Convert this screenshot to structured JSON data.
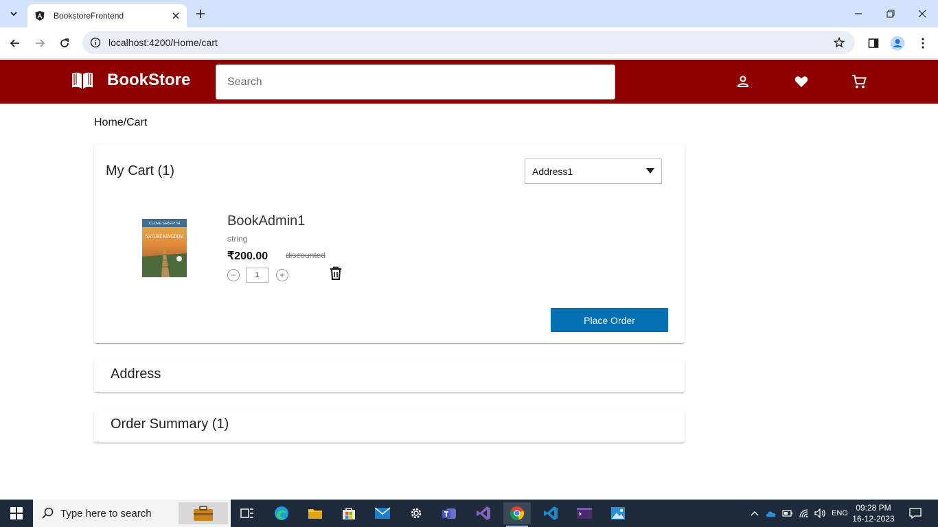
{
  "browser": {
    "tab_title": "BookstoreFrontend",
    "url": "localhost:4200/Home/cart"
  },
  "header": {
    "brand": "BookStore",
    "search_placeholder": "Search",
    "brand_color": "#8f0000"
  },
  "breadcrumb": "Home/Cart",
  "cart": {
    "title": "My Cart (1)",
    "address_select": "Address1",
    "item": {
      "title": "BookAdmin1",
      "author": "string",
      "price": "₹200.00",
      "discount_label": "discounted",
      "quantity": "1",
      "cover_top_text": "CLOVE GRIFFITH",
      "cover_title": "NATURE KINGDOM"
    },
    "place_order_label": "Place Order",
    "accent_color": "#0370b4"
  },
  "sections": {
    "address_title": "Address",
    "summary_title": "Order Summary (1)"
  },
  "taskbar": {
    "search_text": "Type here to search",
    "lang": "ENG",
    "time": "09:28 PM",
    "date": "16-12-2023"
  }
}
